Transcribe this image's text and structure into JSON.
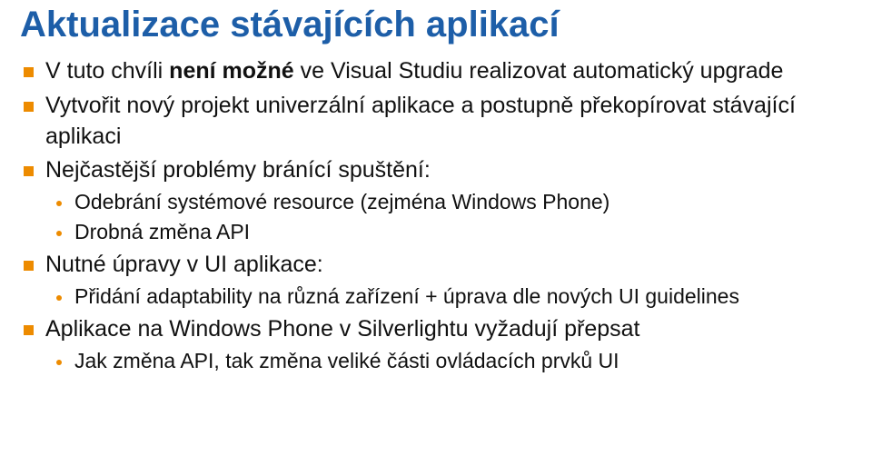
{
  "title": "Aktualizace stávajících aplikací",
  "bullets": {
    "b1_pre": "V tuto chvíli ",
    "b1_bold": "není možné",
    "b1_post": " ve Visual Studiu realizovat automatický upgrade",
    "b2": "Vytvořit nový projekt univerzální aplikace a postupně překopírovat stávající aplikaci",
    "b3": "Nejčastější problémy bránící spuštění:",
    "b3_sub1": "Odebrání systémové resource (zejména Windows Phone)",
    "b3_sub2": "Drobná změna API",
    "b4": "Nutné úpravy v UI aplikace:",
    "b4_sub1": "Přidání adaptability na různá zařízení + úprava dle nových UI guidelines",
    "b5": "Aplikace na Windows Phone v Silverlightu vyžadují přepsat",
    "b5_sub1": "Jak změna API, tak změna veliké části ovládacích prvků UI"
  }
}
